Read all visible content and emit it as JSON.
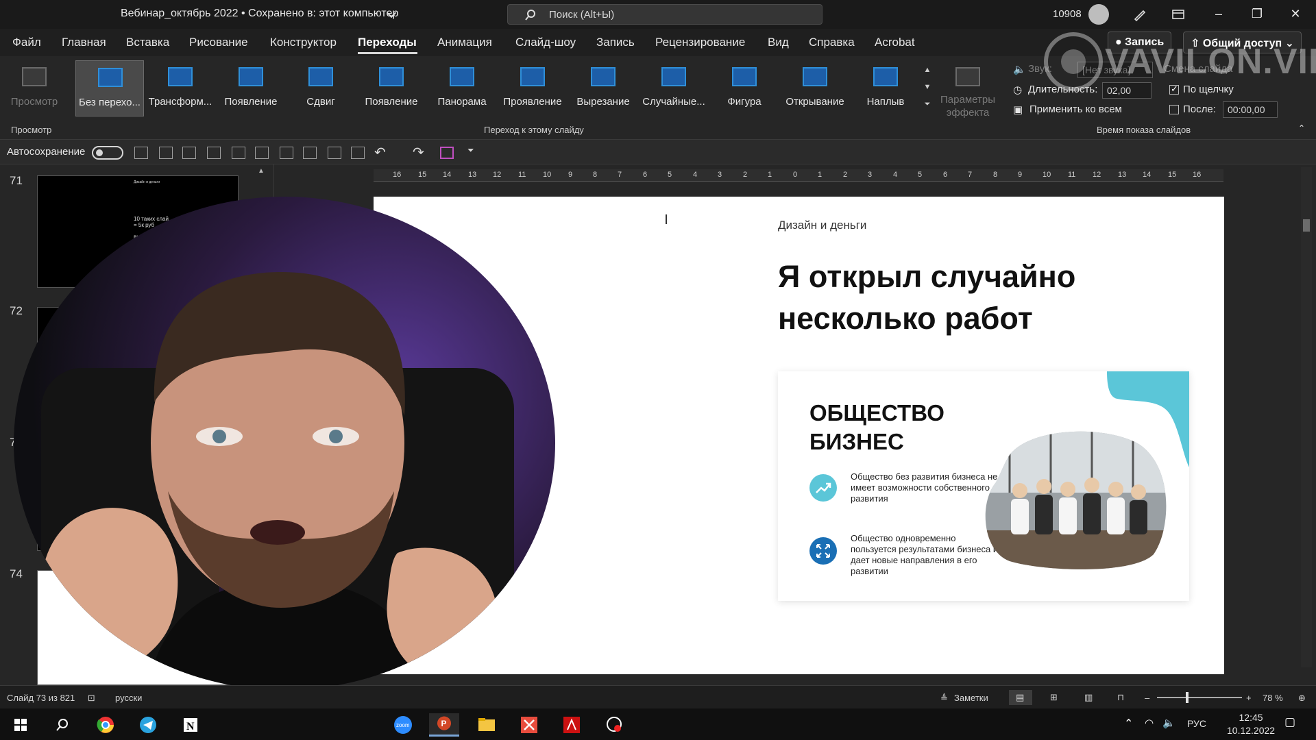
{
  "window": {
    "doc_title": "Вебинар_октябрь 2022 • Сохранено в: этот компьютер",
    "search_placeholder": "Поиск (Alt+Ы)",
    "user_count": "10908"
  },
  "menu": {
    "tabs": [
      "Файл",
      "Главная",
      "Вставка",
      "Рисование",
      "Конструктор",
      "Переходы",
      "Анимация",
      "Слайд-шоу",
      "Запись",
      "Рецензирование",
      "Вид",
      "Справка",
      "Acrobat"
    ],
    "active_tab": "Переходы",
    "record_label": "Запись",
    "share_label": "Общий доступ"
  },
  "ribbon": {
    "preview_label": "Просмотр",
    "preview_group": "Просмотр",
    "transitions": [
      "Без перехо...",
      "Трансформ...",
      "Появление",
      "Сдвиг",
      "Появление",
      "Панорама",
      "Проявление",
      "Вырезание",
      "Случайные...",
      "Фигура",
      "Открывание",
      "Наплыв"
    ],
    "transition_group": "Переход к этому слайду",
    "effect_options": "Параметры эффекта",
    "sound_label": "Звук:",
    "sound_value": "[Нет звука]",
    "duration_label": "Длительность:",
    "duration_value": "02,00",
    "apply_all": "Применить ко всем",
    "advance_label": "Смена слайда",
    "on_click": "По щелчку",
    "after_label": "После:",
    "after_value": "00:00,00",
    "timing_group": "Время показа слайдов"
  },
  "qat": {
    "autosave_label": "Автосохранение"
  },
  "thumbs": {
    "numbers": [
      "71",
      "72",
      "7",
      "74"
    ],
    "thumb71_small": "Дизайн и деньги",
    "thumb71_text": "10 таких слай\n= 5к руб",
    "thumb71_text2": "вы"
  },
  "ruler": {
    "ticks": [
      "16",
      "15",
      "14",
      "13",
      "12",
      "11",
      "10",
      "9",
      "8",
      "7",
      "6",
      "5",
      "4",
      "3",
      "2",
      "1",
      "0",
      "1",
      "2",
      "3",
      "4",
      "5",
      "6",
      "7",
      "8",
      "9",
      "10",
      "11",
      "12",
      "13",
      "14",
      "15",
      "16"
    ]
  },
  "slide": {
    "kicker": "Дизайн и деньги",
    "headline": "Я открыл случайно несколько работ",
    "card_title": "ОБЩЕСТВО\nБИЗНЕС",
    "item1": "Общество без развития бизнеса не имеет возможности собственного развития",
    "item2": "Общество одновременно пользуется результатами бизнеса и дает новые направления в его развитии"
  },
  "watermark": {
    "text": "VAVILON.VIP"
  },
  "status": {
    "slide_info": "Слайд 73 из 821",
    "language": "русски",
    "notes": "Заметки",
    "zoom": "78 %"
  },
  "taskbar": {
    "lang": "РУС",
    "time": "12:45",
    "date": "10.12.2022"
  },
  "colors": {
    "accent_teal": "#5bc6d8",
    "accent_blue": "#1a6fb5",
    "ribbon_blue": "#2f8fd8"
  }
}
